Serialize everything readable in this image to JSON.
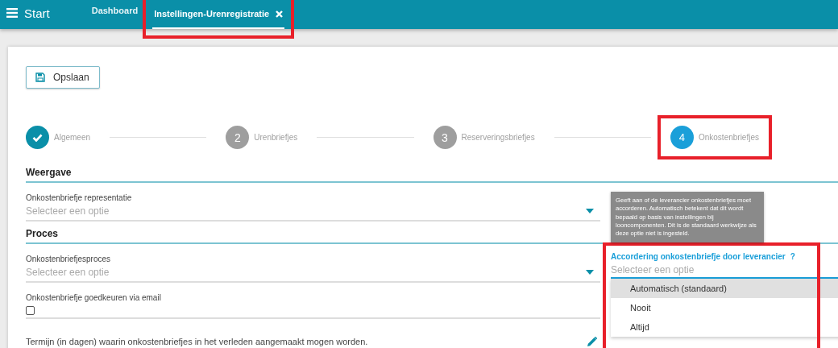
{
  "topbar": {
    "menu_label": "Start",
    "tabs": [
      {
        "label": "Dashboard",
        "selected": false,
        "closable": false,
        "highlighted": false
      },
      {
        "label": "Instellingen-Urenregistratie",
        "selected": true,
        "closable": true,
        "highlighted": true
      }
    ]
  },
  "toolbar": {
    "save_label": "Opslaan"
  },
  "steps": [
    {
      "label": "Algemeen",
      "done": true,
      "active": false,
      "highlighted": false
    },
    {
      "number": "2",
      "label": "Urenbriefjes",
      "done": false,
      "active": false,
      "highlighted": false
    },
    {
      "number": "3",
      "label": "Reserveringsbriefjes",
      "done": false,
      "active": false,
      "highlighted": false
    },
    {
      "number": "4",
      "label": "Onkostenbriefjes",
      "done": false,
      "active": true,
      "highlighted": true
    }
  ],
  "tooltip": {
    "text": "Geeft aan of de leverancier onkostenbriefjes moet accorderen. Automatisch betekent dat dit wordt bepaald op basis van instellingen bij looncomponenten. Dit is de standaard werkwijze als deze optie niet is ingesteld."
  },
  "sections": [
    {
      "title": "Weergave",
      "fields": [
        {
          "kind": "select",
          "label": "Onkostenbriefje representatie",
          "placeholder": "Selecteer een optie"
        }
      ]
    },
    {
      "title": "Proces",
      "fields": [
        {
          "kind": "select",
          "label": "Onkostenbriefjesproces",
          "placeholder": "Selecteer een optie"
        },
        {
          "kind": "checkbox",
          "label": "Onkostenbriefje goedkeuren via email",
          "checked": false
        },
        {
          "kind": "editable",
          "label": "Termijn (in dagen) waarin onkostenbriefjes in het verleden aangemaakt mogen worden."
        }
      ],
      "aside": {
        "label": "Accordering onkostenbriefje door leverancier",
        "help": "?",
        "placeholder": "Selecteer een optie",
        "highlighted": true,
        "options": [
          {
            "label": "Automatisch (standaard)",
            "selected": true
          },
          {
            "label": "Nooit",
            "selected": false
          },
          {
            "label": "Altijd",
            "selected": false
          }
        ]
      }
    }
  ]
}
